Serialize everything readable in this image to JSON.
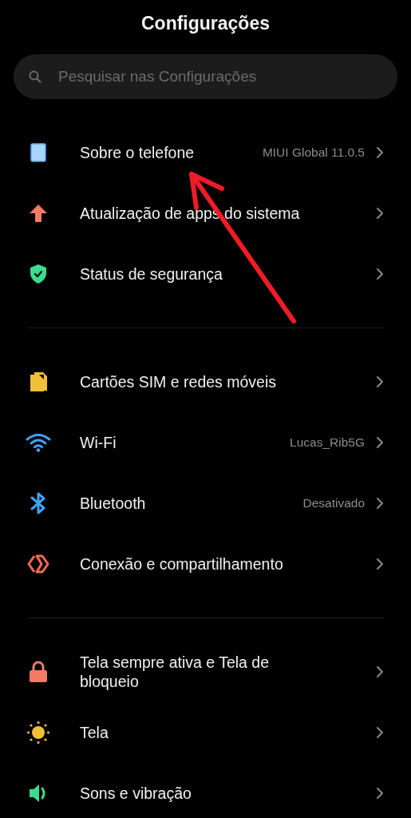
{
  "window": {
    "title": "Configurações"
  },
  "search": {
    "placeholder": "Pesquisar nas Configurações"
  },
  "sections": [
    {
      "items": [
        {
          "label": "Sobre o telefone",
          "value": "MIUI Global 11.0.5"
        },
        {
          "label": "Atualização de apps do sistema"
        },
        {
          "label": "Status de segurança"
        }
      ]
    },
    {
      "items": [
        {
          "label": "Cartões SIM e redes móveis"
        },
        {
          "label": "Wi-Fi",
          "value": "Lucas_Rib5G"
        },
        {
          "label": "Bluetooth",
          "value": "Desativado"
        },
        {
          "label": "Conexão e compartilhamento"
        }
      ]
    },
    {
      "items": [
        {
          "label": "Tela sempre ativa e Tela de bloqueio"
        },
        {
          "label": "Tela"
        },
        {
          "label": "Sons e vibração"
        }
      ]
    }
  ]
}
